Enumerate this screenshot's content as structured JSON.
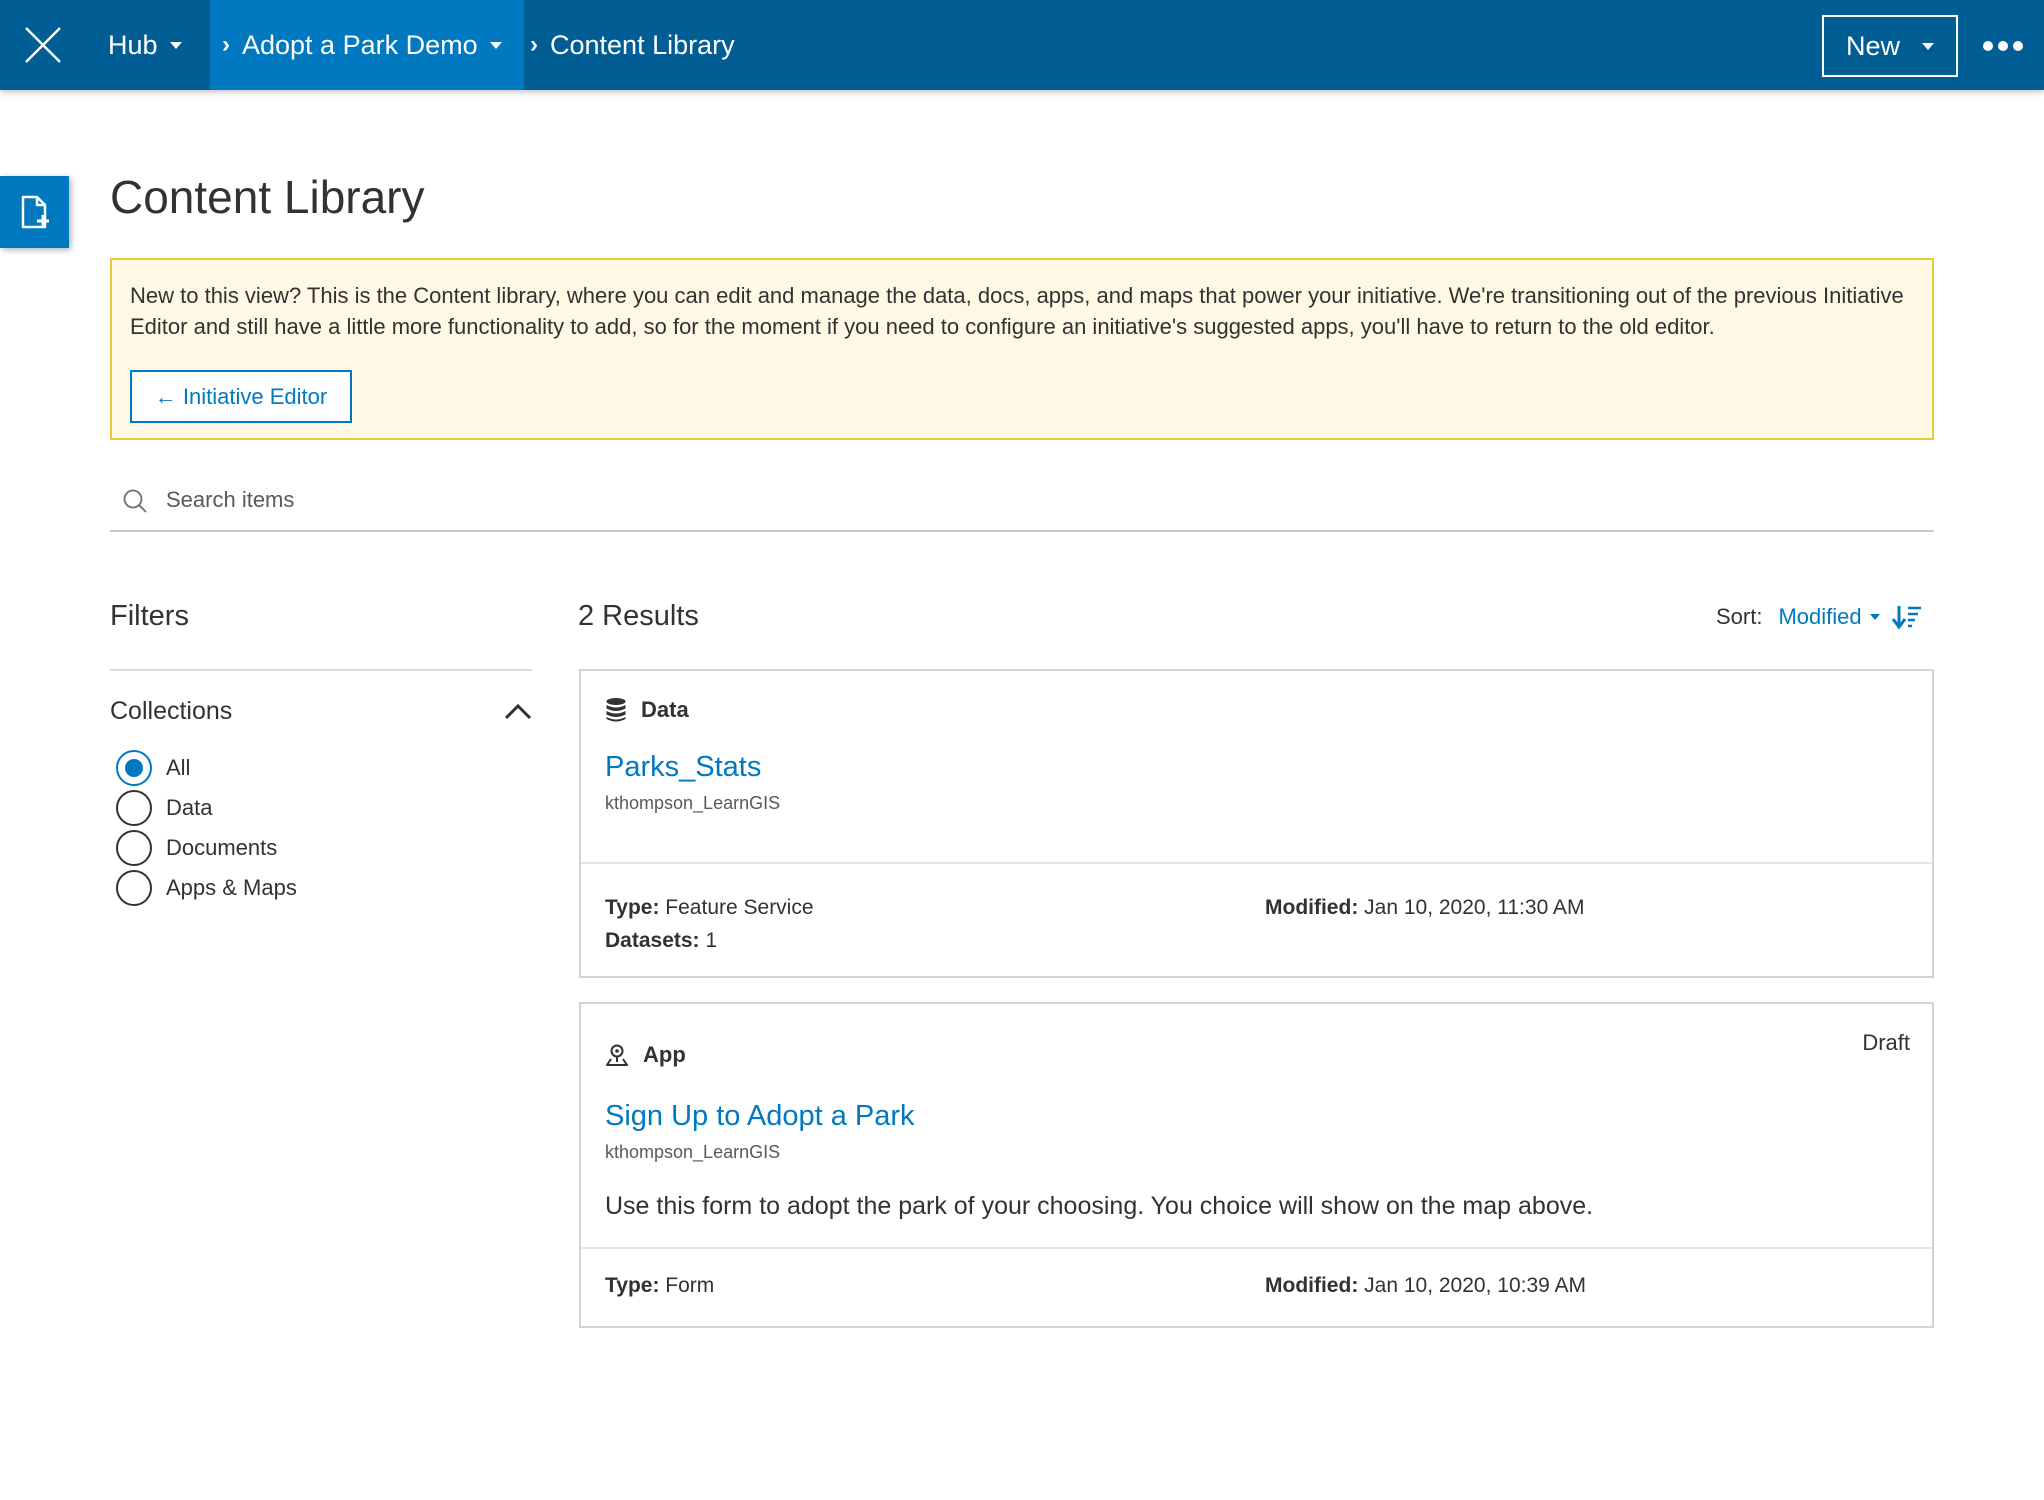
{
  "nav": {
    "hub": "Hub",
    "site": "Adopt a Park Demo",
    "current": "Content Library",
    "new_label": "New"
  },
  "page": {
    "title": "Content Library"
  },
  "notice": {
    "text": "New to this view? This is the Content library, where you can edit and manage the data, docs, apps, and maps that power your initiative. We're transitioning out of the previous Initiative Editor and still have a little more functionality to add, so for the moment if you need to configure an initiative's suggested apps, you'll have to return to the old editor.",
    "button": "← Initiative Editor"
  },
  "search": {
    "placeholder": "Search items",
    "value": ""
  },
  "filters": {
    "title": "Filters",
    "collections_label": "Collections",
    "options": [
      "All",
      "Data",
      "Documents",
      "Apps & Maps"
    ],
    "selected": "All"
  },
  "results": {
    "count_label": "2 Results",
    "sort_label": "Sort:",
    "sort_value": "Modified"
  },
  "items": [
    {
      "category": "Data",
      "title": "Parks_Stats",
      "owner": "kthompson_LearnGIS",
      "type_label": "Type:",
      "type_value": "Feature Service",
      "datasets_label": "Datasets:",
      "datasets_value": "1",
      "modified_label": "Modified:",
      "modified_value": "Jan 10, 2020, 11:30 AM"
    },
    {
      "category": "App",
      "status": "Draft",
      "title": "Sign Up to Adopt a Park",
      "owner": "kthompson_LearnGIS",
      "description": "Use this form to adopt the park of your choosing. You choice will show on the map above.",
      "type_label": "Type:",
      "type_value": "Form",
      "modified_label": "Modified:",
      "modified_value": "Jan 10, 2020, 10:39 AM"
    }
  ],
  "colors": {
    "nav_bg": "#005e95",
    "nav_active": "#0079c1",
    "accent": "#0079c1",
    "notice_bg": "#fef8e5",
    "notice_border": "#e9c83b"
  },
  "icons": {
    "close": "close-icon",
    "more": "more-icon",
    "add_item": "add-item-icon",
    "search": "search-icon",
    "chevron_up": "chevron-up-icon",
    "sort_direction": "sort-descending-icon",
    "data": "database-icon",
    "app": "app-pin-icon"
  }
}
